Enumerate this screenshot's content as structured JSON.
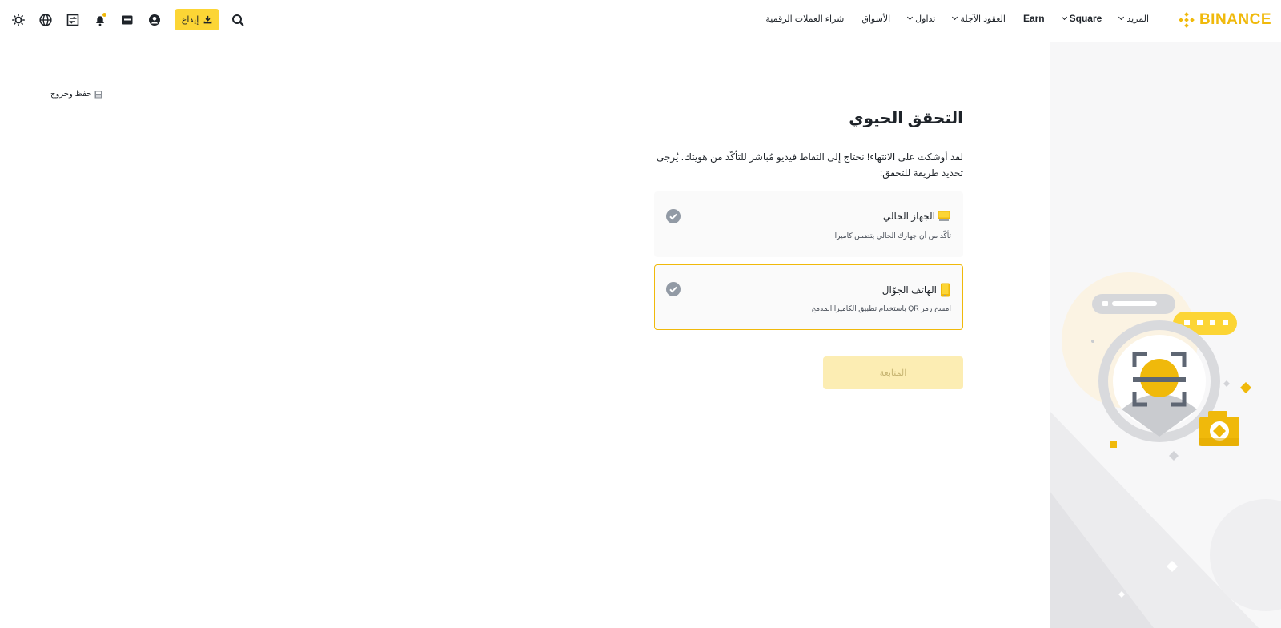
{
  "header": {
    "logo_text": "BINANCE",
    "nav": [
      {
        "label": "شراء العملات الرقمية",
        "dropdown": false,
        "latin": false
      },
      {
        "label": "الأسواق",
        "dropdown": false,
        "latin": false
      },
      {
        "label": "تداول",
        "dropdown": true,
        "latin": false
      },
      {
        "label": "العقود الآجلة",
        "dropdown": true,
        "latin": false
      },
      {
        "label": "Earn",
        "dropdown": false,
        "latin": true
      },
      {
        "label": "Square",
        "dropdown": true,
        "latin": true
      },
      {
        "label": "المزيد",
        "dropdown": true,
        "latin": false
      }
    ],
    "deposit_label": "إيداع",
    "icons": [
      "search-icon",
      "download-icon",
      "user-icon",
      "wallet-icon",
      "bell-icon",
      "transfer-icon",
      "globe-icon",
      "theme-icon"
    ],
    "bell_dot_color": "#f0b90b"
  },
  "save_exit": {
    "label": "حفظ وخروج",
    "icon": "save-icon"
  },
  "main": {
    "title": "التحقق الحيوي",
    "description": "لقد أوشكت على الانتهاء! نحتاج إلى التقاط فيديو مُباشر للتأكّد من هويتك. يُرجى تحديد طريقة للتحقق:",
    "options": [
      {
        "title": "الجهاز الحالي",
        "subtitle": "تأكّد من أن جهازك الحالي يتضمن كاميرا",
        "icon": "computer-icon",
        "selected": false
      },
      {
        "title": "الهاتف الجوّال",
        "subtitle": "امسح رمز QR باستخدام تطبيق الكاميرا المدمج",
        "icon": "mobile-phone-icon",
        "selected": true
      }
    ],
    "continue_label": "المتابعة"
  },
  "colors": {
    "brand": "#f0b90b",
    "button_yellow": "#fcd535",
    "button_disabled": "#fcedb3",
    "card_bg": "#fafafa",
    "side_bg": "#f7f7f8"
  }
}
